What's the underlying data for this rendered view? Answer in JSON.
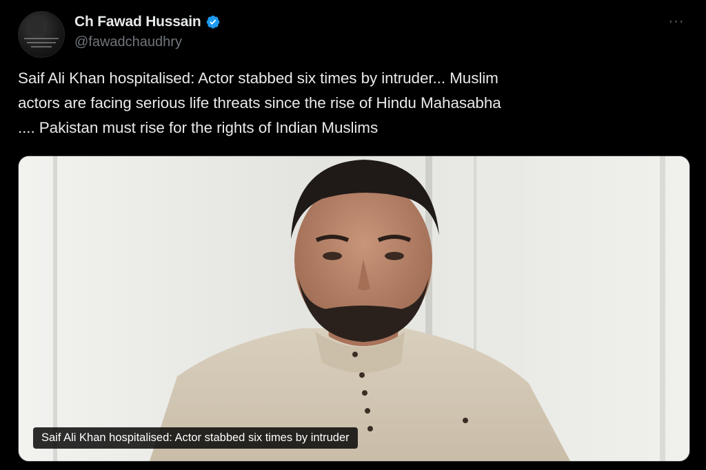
{
  "author": {
    "display_name": "Ch Fawad Hussain",
    "handle": "@fawadchaudhry",
    "verified": true,
    "verified_color": "#1d9bf0",
    "avatar_icon": "profile-avatar"
  },
  "more_menu": {
    "icon": "more-horizontal-icon",
    "glyph": "···"
  },
  "tweet": {
    "text_lines": [
      "Saif Ali Khan hospitalised: Actor stabbed six times by intruder... Muslim",
      "actors are facing serious life threats since the rise of Hindu Mahasabha",
      ".... Pakistan must rise for the rights of Indian Muslims"
    ]
  },
  "media": {
    "caption": "Saif Ali Khan hospitalised: Actor stabbed six times by intruder"
  },
  "colors": {
    "background": "#000000",
    "text_primary": "#e7e9ea",
    "text_secondary": "#71767b",
    "accent": "#1d9bf0"
  }
}
